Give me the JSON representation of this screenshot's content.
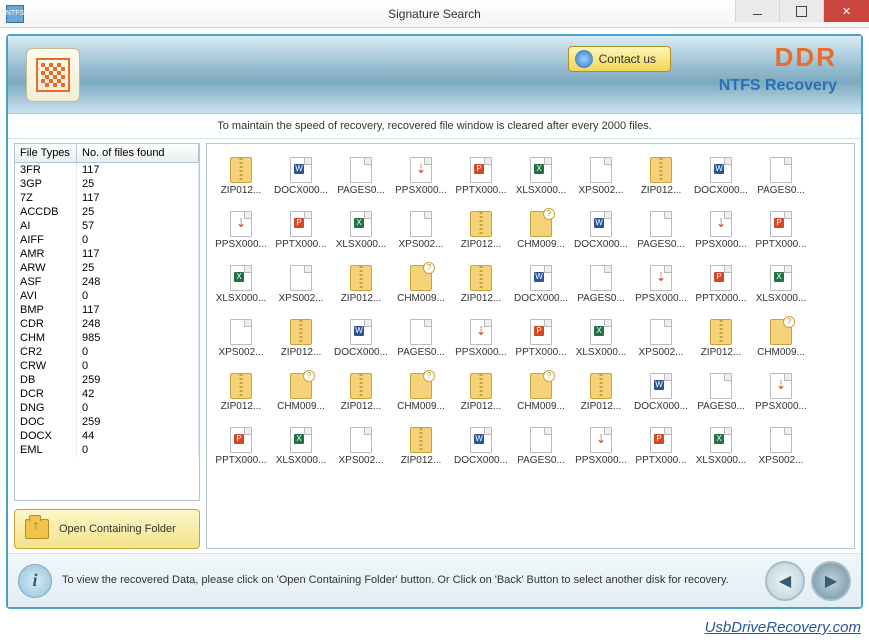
{
  "window": {
    "title": "Signature Search"
  },
  "banner": {
    "contact_label": "Contact us",
    "brand_top": "DDR",
    "brand_sub": "NTFS Recovery"
  },
  "info_strip": "To maintain the speed of recovery, recovered file window is cleared after every 2000 files.",
  "file_types": {
    "col1": "File Types",
    "col2": "No. of files found",
    "rows": [
      {
        "t": "3FR",
        "n": "117"
      },
      {
        "t": "3GP",
        "n": "25"
      },
      {
        "t": "7Z",
        "n": "117"
      },
      {
        "t": "ACCDB",
        "n": "25"
      },
      {
        "t": "AI",
        "n": "57"
      },
      {
        "t": "AIFF",
        "n": "0"
      },
      {
        "t": "AMR",
        "n": "117"
      },
      {
        "t": "ARW",
        "n": "25"
      },
      {
        "t": "ASF",
        "n": "248"
      },
      {
        "t": "AVI",
        "n": "0"
      },
      {
        "t": "BMP",
        "n": "117"
      },
      {
        "t": "CDR",
        "n": "248"
      },
      {
        "t": "CHM",
        "n": "985"
      },
      {
        "t": "CR2",
        "n": "0"
      },
      {
        "t": "CRW",
        "n": "0"
      },
      {
        "t": "DB",
        "n": "259"
      },
      {
        "t": "DCR",
        "n": "42"
      },
      {
        "t": "DNG",
        "n": "0"
      },
      {
        "t": "DOC",
        "n": "259"
      },
      {
        "t": "DOCX",
        "n": "44"
      },
      {
        "t": "EML",
        "n": "0"
      }
    ]
  },
  "open_folder_label": "Open Containing Folder",
  "grid": [
    {
      "l": "ZIP012...",
      "i": "zip"
    },
    {
      "l": "DOCX000...",
      "i": "docx"
    },
    {
      "l": "PAGES0...",
      "i": "pages"
    },
    {
      "l": "PPSX000...",
      "i": "ppsx"
    },
    {
      "l": "PPTX000...",
      "i": "ppt"
    },
    {
      "l": "XLSX000...",
      "i": "xls"
    },
    {
      "l": "XPS002...",
      "i": "doc"
    },
    {
      "l": "ZIP012...",
      "i": "zip"
    },
    {
      "l": "DOCX000...",
      "i": "docx"
    },
    {
      "l": "PAGES0...",
      "i": "pages"
    },
    {
      "l": "PPSX000...",
      "i": "ppsx"
    },
    {
      "l": "PPTX000...",
      "i": "ppt"
    },
    {
      "l": "XLSX000...",
      "i": "xls"
    },
    {
      "l": "XPS002...",
      "i": "doc"
    },
    {
      "l": "ZIP012...",
      "i": "zip"
    },
    {
      "l": "CHM009...",
      "i": "chm"
    },
    {
      "l": "DOCX000...",
      "i": "docx"
    },
    {
      "l": "PAGES0...",
      "i": "pages"
    },
    {
      "l": "PPSX000...",
      "i": "ppsx"
    },
    {
      "l": "PPTX000...",
      "i": "ppt"
    },
    {
      "l": "XLSX000...",
      "i": "xls"
    },
    {
      "l": "XPS002...",
      "i": "doc"
    },
    {
      "l": "ZIP012...",
      "i": "zip"
    },
    {
      "l": "CHM009...",
      "i": "chm"
    },
    {
      "l": "ZIP012...",
      "i": "zip"
    },
    {
      "l": "DOCX000...",
      "i": "docx"
    },
    {
      "l": "PAGES0...",
      "i": "pages"
    },
    {
      "l": "PPSX000...",
      "i": "ppsx"
    },
    {
      "l": "PPTX000...",
      "i": "ppt"
    },
    {
      "l": "XLSX000...",
      "i": "xls"
    },
    {
      "l": "XPS002...",
      "i": "doc"
    },
    {
      "l": "ZIP012...",
      "i": "zip"
    },
    {
      "l": "DOCX000...",
      "i": "docx"
    },
    {
      "l": "PAGES0...",
      "i": "pages"
    },
    {
      "l": "PPSX000...",
      "i": "ppsx"
    },
    {
      "l": "PPTX000...",
      "i": "ppt"
    },
    {
      "l": "XLSX000...",
      "i": "xls"
    },
    {
      "l": "XPS002...",
      "i": "doc"
    },
    {
      "l": "ZIP012...",
      "i": "zip"
    },
    {
      "l": "CHM009...",
      "i": "chm"
    },
    {
      "l": "ZIP012...",
      "i": "zip"
    },
    {
      "l": "CHM009...",
      "i": "chm"
    },
    {
      "l": "ZIP012...",
      "i": "zip"
    },
    {
      "l": "CHM009...",
      "i": "chm"
    },
    {
      "l": "ZIP012...",
      "i": "zip"
    },
    {
      "l": "CHM009...",
      "i": "chm"
    },
    {
      "l": "ZIP012...",
      "i": "zip"
    },
    {
      "l": "DOCX000...",
      "i": "docx"
    },
    {
      "l": "PAGES0...",
      "i": "pages"
    },
    {
      "l": "PPSX000...",
      "i": "ppsx"
    },
    {
      "l": "PPTX000...",
      "i": "ppt"
    },
    {
      "l": "XLSX000...",
      "i": "xls"
    },
    {
      "l": "XPS002...",
      "i": "doc"
    },
    {
      "l": "ZIP012...",
      "i": "zip"
    },
    {
      "l": "DOCX000...",
      "i": "docx"
    },
    {
      "l": "PAGES0...",
      "i": "pages"
    },
    {
      "l": "PPSX000...",
      "i": "ppsx"
    },
    {
      "l": "PPTX000...",
      "i": "ppt"
    },
    {
      "l": "XLSX000...",
      "i": "xls"
    },
    {
      "l": "XPS002...",
      "i": "doc"
    }
  ],
  "footer": {
    "message": "To view the recovered Data, please click on 'Open Containing Folder' button. Or Click on 'Back' Button to select another disk for recovery."
  },
  "bottom_link": "UsbDriveRecovery.com"
}
